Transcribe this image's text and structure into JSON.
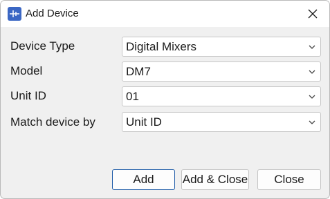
{
  "window": {
    "title": "Add Device",
    "app_icon": "app-icon",
    "close_icon": "close-icon"
  },
  "form": {
    "device_type": {
      "label": "Device Type",
      "value": "Digital Mixers"
    },
    "model": {
      "label": "Model",
      "value": "DM7"
    },
    "unit_id": {
      "label": "Unit ID",
      "value": "01"
    },
    "match_by": {
      "label": "Match device by",
      "value": "Unit ID"
    }
  },
  "buttons": {
    "add": "Add",
    "add_close": "Add & Close",
    "close": "Close"
  },
  "colors": {
    "accent": "#1f5ca8",
    "icon_bg": "#3b67c4"
  }
}
